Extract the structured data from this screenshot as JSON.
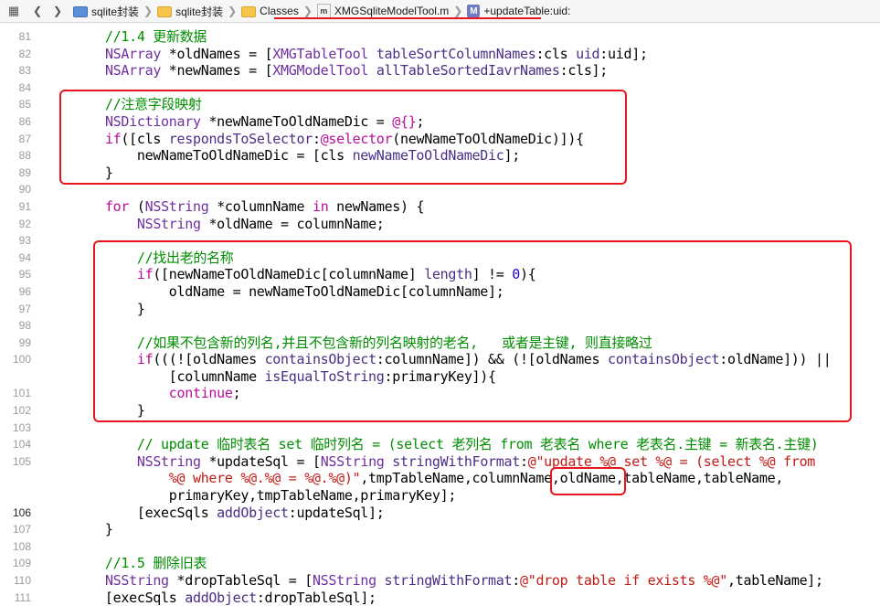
{
  "jumpbar": {
    "items": [
      "sqlite封装",
      "sqlite封装",
      "Classes",
      "XMGSqliteModelTool.m",
      "+updateTable:uid:"
    ]
  },
  "colors": {
    "comment": "#008e00",
    "keyword": "#b80d9c",
    "type": "#7030a0",
    "method": "#4b2e87",
    "string": "#c41a16",
    "number": "#1c00cf",
    "plain": "#000000",
    "highlight_box": "#e8161c"
  },
  "editor": {
    "current_line": 106,
    "lines": [
      {
        "n": "81",
        "segs": [
          [
            "c",
            "    //1.4 更新数据"
          ]
        ]
      },
      {
        "n": "82",
        "segs": [
          [
            "p",
            "    "
          ],
          [
            "t",
            "NSArray"
          ],
          [
            "p",
            " *oldNames = ["
          ],
          [
            "t",
            "XMGTableTool"
          ],
          [
            "p",
            " "
          ],
          [
            "m",
            "tableSortColumnNames"
          ],
          [
            "p",
            ":cls "
          ],
          [
            "m",
            "uid"
          ],
          [
            "p",
            ":uid];"
          ]
        ]
      },
      {
        "n": "83",
        "segs": [
          [
            "p",
            "    "
          ],
          [
            "t",
            "NSArray"
          ],
          [
            "p",
            " *newNames = ["
          ],
          [
            "t",
            "XMGModelTool"
          ],
          [
            "p",
            " "
          ],
          [
            "m",
            "allTableSortedIavrNames"
          ],
          [
            "p",
            ":cls];"
          ]
        ]
      },
      {
        "n": "84",
        "segs": []
      },
      {
        "n": "85",
        "segs": [
          [
            "c",
            "    //注意字段映射"
          ]
        ]
      },
      {
        "n": "86",
        "segs": [
          [
            "p",
            "    "
          ],
          [
            "t",
            "NSDictionary"
          ],
          [
            "p",
            " *newNameToOldNameDic = "
          ],
          [
            "k",
            "@{}"
          ],
          [
            "p",
            ";"
          ]
        ]
      },
      {
        "n": "87",
        "segs": [
          [
            "p",
            "    "
          ],
          [
            "k",
            "if"
          ],
          [
            "p",
            "([cls "
          ],
          [
            "m",
            "respondsToSelector"
          ],
          [
            "p",
            ":"
          ],
          [
            "k",
            "@selector"
          ],
          [
            "p",
            "(newNameToOldNameDic)]){"
          ]
        ]
      },
      {
        "n": "88",
        "segs": [
          [
            "p",
            "        newNameToOldNameDic = [cls "
          ],
          [
            "m",
            "newNameToOldNameDic"
          ],
          [
            "p",
            "];"
          ]
        ]
      },
      {
        "n": "89",
        "segs": [
          [
            "p",
            "    }"
          ]
        ]
      },
      {
        "n": "90",
        "segs": []
      },
      {
        "n": "91",
        "segs": [
          [
            "p",
            "    "
          ],
          [
            "k",
            "for"
          ],
          [
            "p",
            " ("
          ],
          [
            "t",
            "NSString"
          ],
          [
            "p",
            " *columnName "
          ],
          [
            "k",
            "in"
          ],
          [
            "p",
            " newNames) {"
          ]
        ]
      },
      {
        "n": "92",
        "segs": [
          [
            "p",
            "        "
          ],
          [
            "t",
            "NSString"
          ],
          [
            "p",
            " *oldName = columnName;"
          ]
        ]
      },
      {
        "n": "93",
        "segs": []
      },
      {
        "n": "94",
        "segs": [
          [
            "c",
            "        //找出老的名称"
          ]
        ]
      },
      {
        "n": "95",
        "segs": [
          [
            "p",
            "        "
          ],
          [
            "k",
            "if"
          ],
          [
            "p",
            "([newNameToOldNameDic[columnName] "
          ],
          [
            "m",
            "length"
          ],
          [
            "p",
            "] != "
          ],
          [
            "n",
            "0"
          ],
          [
            "p",
            "){"
          ]
        ]
      },
      {
        "n": "96",
        "segs": [
          [
            "p",
            "            oldName = newNameToOldNameDic[columnName];"
          ]
        ]
      },
      {
        "n": "97",
        "segs": [
          [
            "p",
            "        }"
          ]
        ]
      },
      {
        "n": "98",
        "segs": []
      },
      {
        "n": "99",
        "segs": [
          [
            "c",
            "        //如果不包含新的列名,并且不包含新的列名映射的老名,   或者是主键, 则直接略过"
          ]
        ]
      },
      {
        "n": "100",
        "segs": [
          [
            "p",
            "        "
          ],
          [
            "k",
            "if"
          ],
          [
            "p",
            "(((![oldNames "
          ],
          [
            "m",
            "containsObject"
          ],
          [
            "p",
            ":columnName]) && (![oldNames "
          ],
          [
            "m",
            "containsObject"
          ],
          [
            "p",
            ":oldName])) ||"
          ]
        ]
      },
      {
        "n": "",
        "segs": [
          [
            "p",
            "            [columnName "
          ],
          [
            "m",
            "isEqualToString"
          ],
          [
            "p",
            ":primaryKey]){"
          ]
        ]
      },
      {
        "n": "101",
        "segs": [
          [
            "p",
            "            "
          ],
          [
            "k",
            "continue"
          ],
          [
            "p",
            ";"
          ]
        ]
      },
      {
        "n": "102",
        "segs": [
          [
            "p",
            "        }"
          ]
        ]
      },
      {
        "n": "103",
        "segs": []
      },
      {
        "n": "104",
        "segs": [
          [
            "c",
            "        // update 临时表名 set 临时列名 = (select 老列名 from 老表名 where 老表名.主键 = 新表名.主键)"
          ]
        ]
      },
      {
        "n": "105",
        "segs": [
          [
            "p",
            "        "
          ],
          [
            "t",
            "NSString"
          ],
          [
            "p",
            " *updateSql = ["
          ],
          [
            "t",
            "NSString"
          ],
          [
            "p",
            " "
          ],
          [
            "m",
            "stringWithFormat"
          ],
          [
            "p",
            ":"
          ],
          [
            "s",
            "@\"update %@ set %@ = (select %@ from"
          ]
        ]
      },
      {
        "n": "",
        "segs": [
          [
            "s",
            "            %@ where %@.%@ = %@.%@)\""
          ],
          [
            "p",
            ",tmpTableName,columnName,oldName,tableName,tableName,"
          ]
        ]
      },
      {
        "n": "",
        "segs": [
          [
            "p",
            "            primaryKey,tmpTableName,primaryKey];"
          ]
        ]
      },
      {
        "n": "106",
        "segs": [
          [
            "p",
            "        [execSqls "
          ],
          [
            "m",
            "addObject"
          ],
          [
            "p",
            ":updateSql];"
          ]
        ]
      },
      {
        "n": "107",
        "segs": [
          [
            "p",
            "    }"
          ]
        ]
      },
      {
        "n": "108",
        "segs": []
      },
      {
        "n": "109",
        "segs": [
          [
            "c",
            "    //1.5 删除旧表"
          ]
        ]
      },
      {
        "n": "110",
        "segs": [
          [
            "p",
            "    "
          ],
          [
            "t",
            "NSString"
          ],
          [
            "p",
            " *dropTableSql = ["
          ],
          [
            "t",
            "NSString"
          ],
          [
            "p",
            " "
          ],
          [
            "m",
            "stringWithFormat"
          ],
          [
            "p",
            ":"
          ],
          [
            "s",
            "@\"drop table if exists %@\""
          ],
          [
            "p",
            ",tableName];"
          ]
        ]
      },
      {
        "n": "111",
        "segs": [
          [
            "p",
            "    [execSqls "
          ],
          [
            "m",
            "addObject"
          ],
          [
            "p",
            ":dropTableSql];"
          ]
        ]
      }
    ]
  }
}
